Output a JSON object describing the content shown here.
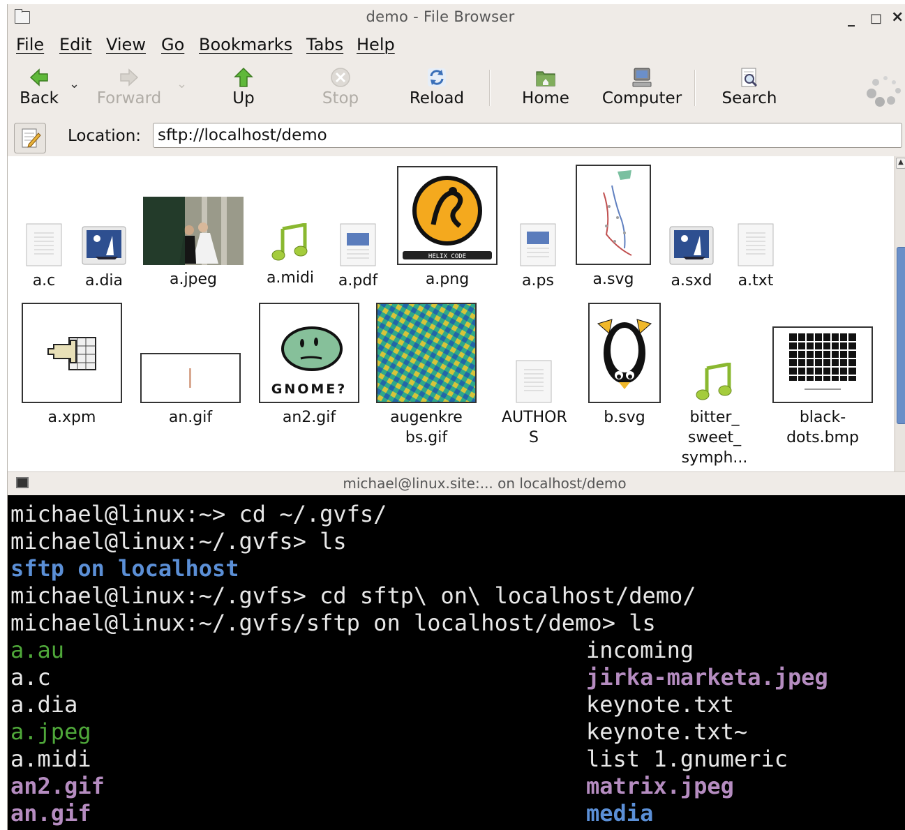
{
  "window": {
    "title": "demo - File Browser",
    "minimize": "_",
    "maximize": "□",
    "close": "×"
  },
  "menu": [
    "File",
    "Edit",
    "View",
    "Go",
    "Bookmarks",
    "Tabs",
    "Help"
  ],
  "toolbar": {
    "back": "Back",
    "forward": "Forward",
    "up": "Up",
    "stop": "Stop",
    "reload": "Reload",
    "home": "Home",
    "computer": "Computer",
    "search": "Search"
  },
  "location": {
    "label": "Location:",
    "value": "sftp://localhost/demo"
  },
  "files": {
    "row1": [
      "a.c",
      "a.dia",
      "a.jpeg",
      "a.midi",
      "a.pdf",
      "a.png",
      "a.ps",
      "a.svg",
      "a.sxd",
      "a.txt"
    ],
    "row2": [
      "a.xpm",
      "an.gif",
      "an2.gif",
      "augenkre\nbs.gif",
      "AUTHOR\nS",
      "b.svg",
      "bitter_\nsweet_\nsymph...",
      "black-\ndots.bmp"
    ],
    "png_banner": "HELIX CODE",
    "gnome_text": "GNOME?"
  },
  "terminal": {
    "title": "michael@linux.site:... on localhost/demo",
    "lines": [
      "michael@linux:~> cd ~/.gvfs/",
      "michael@linux:~/.gvfs> ls",
      "sftp on localhost",
      "michael@linux:~/.gvfs> cd sftp\\ on\\ localhost/demo/",
      "michael@linux:~/.gvfs/sftp on localhost/demo> ls"
    ],
    "col1": [
      "a.au",
      "a.c",
      "a.dia",
      "a.jpeg",
      "a.midi",
      "an2.gif",
      "an.gif"
    ],
    "col2": [
      "incoming",
      "jirka-marketa.jpeg",
      "keynote.txt",
      "keynote.txt~",
      "list 1.gnumeric",
      "matrix.jpeg",
      "media"
    ],
    "colors": {
      "dir": "#5b8fd6",
      "exec": "#4fa83a",
      "image": "#b58cc0",
      "plain": "#e8e8e8"
    }
  }
}
